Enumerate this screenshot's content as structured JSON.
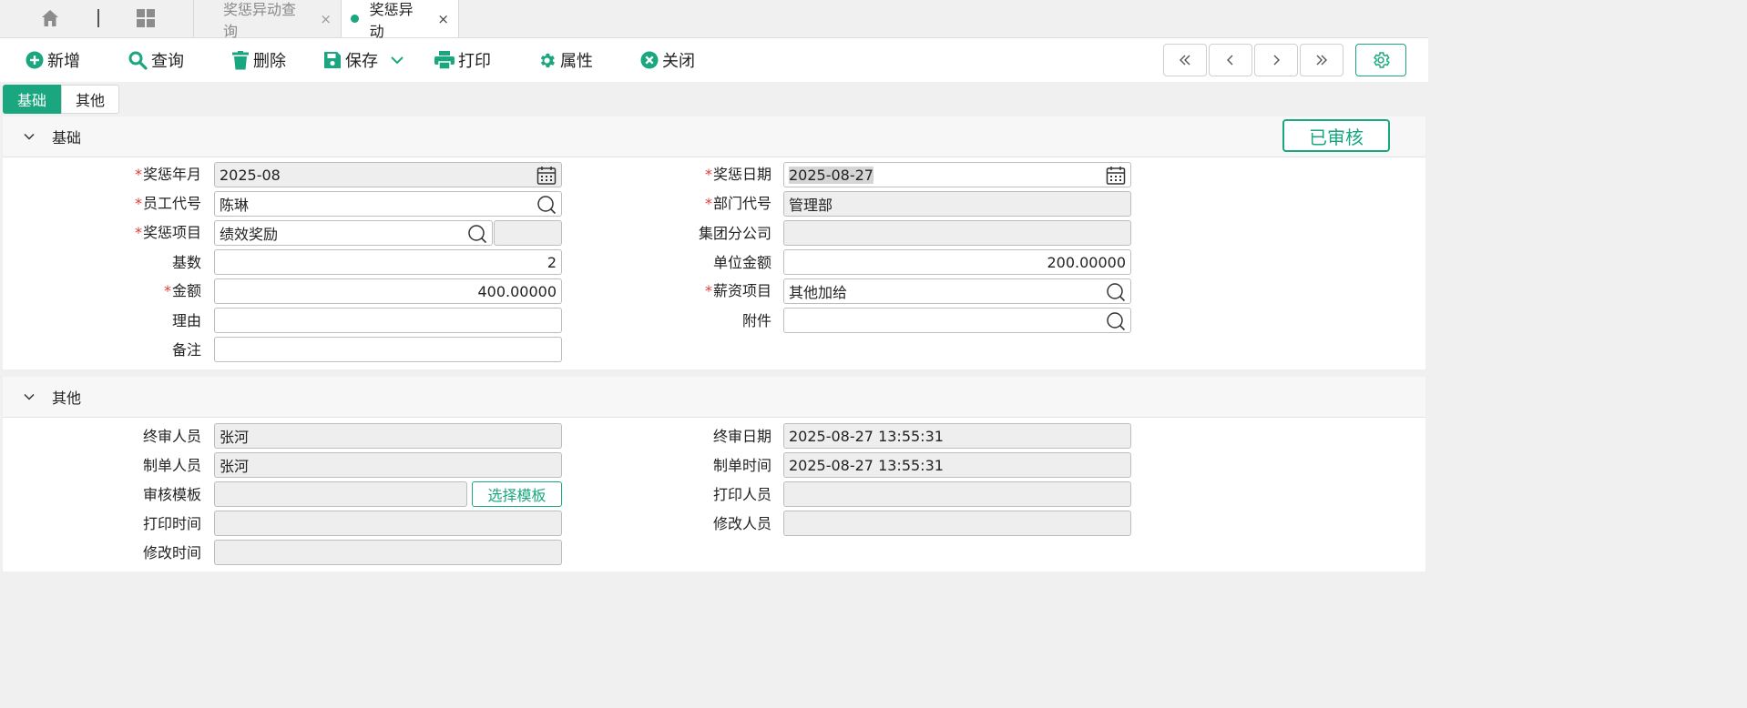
{
  "tabs": [
    {
      "label": "奖惩异动查询",
      "close": "×"
    },
    {
      "label": "奖惩异动",
      "close": "×"
    }
  ],
  "toolbar": {
    "add": "新增",
    "query": "查询",
    "delete": "删除",
    "save": "保存",
    "print": "打印",
    "props": "属性",
    "close": "关闭"
  },
  "subtabs": [
    "基础",
    "其他"
  ],
  "status_badge": "已审核",
  "sections": {
    "basic": "基础",
    "other": "其他"
  },
  "basic": {
    "year_month": {
      "label": "奖惩年月",
      "value": "2025-08"
    },
    "date": {
      "label": "奖惩日期",
      "value": "2025-08-27"
    },
    "employee": {
      "label": "员工代号",
      "value": "陈琳"
    },
    "dept": {
      "label": "部门代号",
      "value": "管理部"
    },
    "item": {
      "label": "奖惩项目",
      "value": "绩效奖励",
      "extra": ""
    },
    "branch": {
      "label": "集团分公司",
      "value": ""
    },
    "base": {
      "label": "基数",
      "value": "2"
    },
    "unit_amount": {
      "label": "单位金额",
      "value": "200.00000"
    },
    "amount": {
      "label": "金额",
      "value": "400.00000"
    },
    "salary_item": {
      "label": "薪资项目",
      "value": "其他加给"
    },
    "reason": {
      "label": "理由",
      "value": ""
    },
    "attachment": {
      "label": "附件",
      "value": ""
    },
    "remark": {
      "label": "备注",
      "value": ""
    }
  },
  "other": {
    "final_reviewer": {
      "label": "终审人员",
      "value": "张河"
    },
    "final_date": {
      "label": "终审日期",
      "value": "2025-08-27 13:55:31"
    },
    "creator": {
      "label": "制单人员",
      "value": "张河"
    },
    "create_time": {
      "label": "制单时间",
      "value": "2025-08-27 13:55:31"
    },
    "review_template": {
      "label": "审核模板",
      "value": "",
      "button": "选择模板"
    },
    "printer": {
      "label": "打印人员",
      "value": ""
    },
    "print_time": {
      "label": "打印时间",
      "value": ""
    },
    "modifier": {
      "label": "修改人员",
      "value": ""
    },
    "modify_time": {
      "label": "修改时间",
      "value": ""
    }
  },
  "colors": {
    "accent": "#1aa77f",
    "required": "#e53935"
  }
}
